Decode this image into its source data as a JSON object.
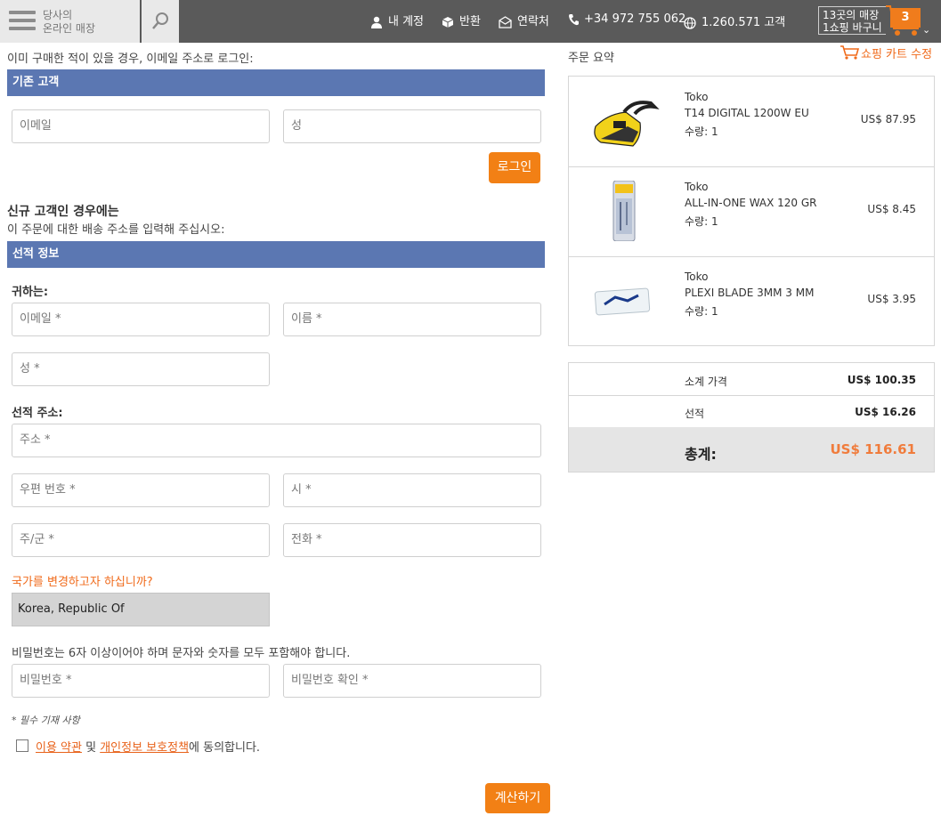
{
  "header": {
    "store_line1": "당사의",
    "store_line2": "온라인 매장",
    "nav": {
      "account": "내 계정",
      "returns": "반환",
      "contact": "연락처",
      "phone": "+34 972 755 062",
      "customers": "1.260.571 고객"
    },
    "cart": {
      "stores_line": "13곳의 매장",
      "cart_line": "1쇼핑 바구니",
      "count": "3"
    }
  },
  "login": {
    "intro": "이미 구매한 적이 있을 경우, 이메일 주소로 로그인:",
    "section_title": "기존 고객",
    "email_placeholder": "이메일",
    "lastname_placeholder": "성",
    "login_button": "로그인"
  },
  "new_customer": {
    "heading": "신규 고객인 경우에는",
    "subheading": "이 주문에 대한 배송 주소를 입력해 주십시오:",
    "section_title": "선적 정보",
    "recipient_label": "귀하는:",
    "email_placeholder": "이메일 *",
    "firstname_placeholder": "이름 *",
    "lastname_placeholder": "성 *",
    "address_label": "선적 주소:",
    "address_placeholder": "주소 *",
    "zip_placeholder": "우편 번호 *",
    "city_placeholder": "시 *",
    "state_placeholder": "주/군 *",
    "phone_placeholder": "전화 *",
    "country_change_link": "국가를 변경하고자 하십니까?",
    "country_value": "Korea, Republic Of",
    "password_note": "비밀번호는 6자 이상이어야 하며 문자와 숫자를 모두 포함해야 합니다.",
    "password_placeholder": "비밀번호 *",
    "password_confirm_placeholder": "비밀번호 확인 *",
    "required_note": "* 필수 기재 사항",
    "terms_link": "이용 약관",
    "terms_and": " 및 ",
    "privacy_link": "개인정보 보호정책",
    "terms_suffix": "에 동의합니다.",
    "checkout_button": "계산하기"
  },
  "summary": {
    "title": "주문 요약",
    "edit_cart": "쇼핑 카트 수정",
    "items": [
      {
        "brand": "Toko",
        "name": "T14 DIGITAL 1200W EU",
        "qty": "수량: 1",
        "price": "US$ 87.95",
        "image_icon": "wax-iron-icon"
      },
      {
        "brand": "Toko",
        "name": "ALL-IN-ONE WAX 120 GR",
        "qty": "수량: 1",
        "price": "US$ 8.45",
        "image_icon": "wax-bar-icon"
      },
      {
        "brand": "Toko",
        "name": "PLEXI BLADE 3MM 3 MM",
        "qty": "수량: 1",
        "price": "US$ 3.95",
        "image_icon": "plexi-blade-icon"
      }
    ],
    "subtotal_label": "소계 가격",
    "subtotal_value": "US$ 100.35",
    "shipping_label": "선적",
    "shipping_value": "US$ 16.26",
    "total_label": "총계:",
    "total_value": "US$ 116.61"
  },
  "colors": {
    "accent_orange": "#f28015",
    "section_blue": "#5b77b2",
    "header_gray": "#5a5a5a"
  }
}
